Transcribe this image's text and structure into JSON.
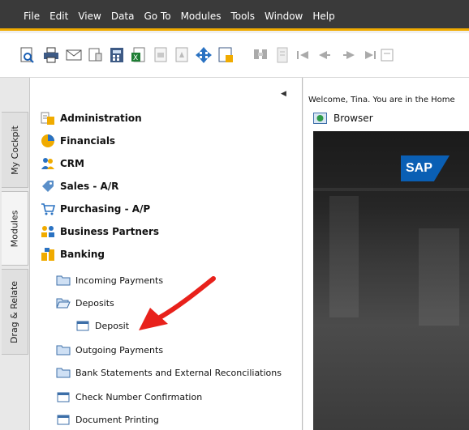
{
  "menu": [
    "File",
    "Edit",
    "View",
    "Data",
    "Go To",
    "Modules",
    "Tools",
    "Window",
    "Help"
  ],
  "toolbar_icons": [
    "print-preview-icon",
    "print-icon",
    "email-icon",
    "export-icon",
    "calculator-icon",
    "excel-icon",
    "word-icon",
    "pdf-icon",
    "move-icon",
    "lock-icon",
    "find-icon",
    "add-icon",
    "first-record-icon",
    "previous-record-icon",
    "next-record-icon",
    "last-record-icon",
    "filter-icon"
  ],
  "vertical_tabs": [
    "My Cockpit",
    "Modules",
    "Drag & Relate"
  ],
  "tree": [
    {
      "label": "Administration",
      "level": 1,
      "icon": "administration-icon"
    },
    {
      "label": "Financials",
      "level": 1,
      "icon": "financials-icon"
    },
    {
      "label": "CRM",
      "level": 1,
      "icon": "crm-icon"
    },
    {
      "label": "Sales - A/R",
      "level": 1,
      "icon": "sales-icon"
    },
    {
      "label": "Purchasing - A/P",
      "level": 1,
      "icon": "purchasing-icon"
    },
    {
      "label": "Business Partners",
      "level": 1,
      "icon": "business-partners-icon"
    },
    {
      "label": "Banking",
      "level": 1,
      "icon": "banking-icon"
    },
    {
      "label": "Incoming Payments",
      "level": 2,
      "icon": "folder-icon"
    },
    {
      "label": "Deposits",
      "level": 2,
      "icon": "folder-open-icon"
    },
    {
      "label": "Deposit",
      "level": 3,
      "icon": "form-icon"
    },
    {
      "label": "Outgoing Payments",
      "level": 2,
      "icon": "folder-icon"
    },
    {
      "label": "Bank Statements and External Reconciliations",
      "level": 2,
      "icon": "folder-icon"
    },
    {
      "label": "Check Number Confirmation",
      "level": 2,
      "icon": "form-icon"
    },
    {
      "label": "Document Printing",
      "level": 2,
      "icon": "form-icon"
    }
  ],
  "welcome_text": "Welcome, Tina. You are in the Home",
  "browser_label": "Browser",
  "logo_text": "SAP",
  "colors": {
    "menubar": "#3a3a3a",
    "accent": "#f0ab00",
    "arrow": "#e8211b",
    "sap_blue": "#0a5fb4"
  }
}
